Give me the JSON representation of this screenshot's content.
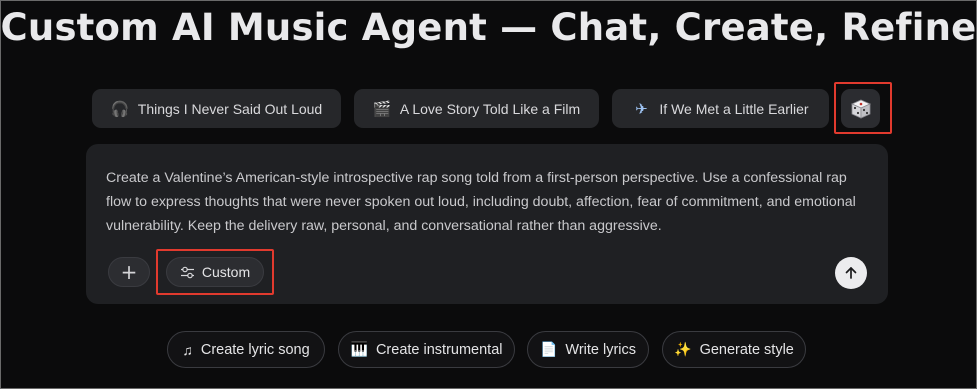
{
  "title": "Custom AI Music Agent — Chat, Create, Refine",
  "suggestions": [
    {
      "label": "Things I Never Said Out Loud",
      "icon": "headphones-icon",
      "glyph": "🎧"
    },
    {
      "label": "A Love Story Told Like a Film",
      "icon": "clapperboard-icon",
      "glyph": "🎬"
    },
    {
      "label": "If We Met a Little Earlier",
      "icon": "airplane-icon",
      "glyph": "✈"
    }
  ],
  "dice": {
    "icon": "dice-icon"
  },
  "composer": {
    "prompt": "Create a Valentine’s American-style introspective rap song told from a first-person perspective. Use a confessional rap flow to express thoughts that were never spoken out loud, including doubt, affection, fear of commitment, and emotional vulnerability. Keep the delivery raw, personal, and conversational rather than aggressive.",
    "add_label": "+",
    "custom_label": "Custom",
    "send_icon": "arrow-up-icon"
  },
  "actions": [
    {
      "label": "Create lyric song",
      "icon": "music-note-icon",
      "glyph": "♫"
    },
    {
      "label": "Create instrumental",
      "icon": "piano-icon",
      "glyph": "🎹"
    },
    {
      "label": "Write lyrics",
      "icon": "document-icon",
      "glyph": "📄"
    },
    {
      "label": "Generate style",
      "icon": "sparkles-icon",
      "glyph": "✨"
    }
  ],
  "colors": {
    "background": "#0b0b0c",
    "highlight": "#e13a2e",
    "chip": "#26272a"
  }
}
